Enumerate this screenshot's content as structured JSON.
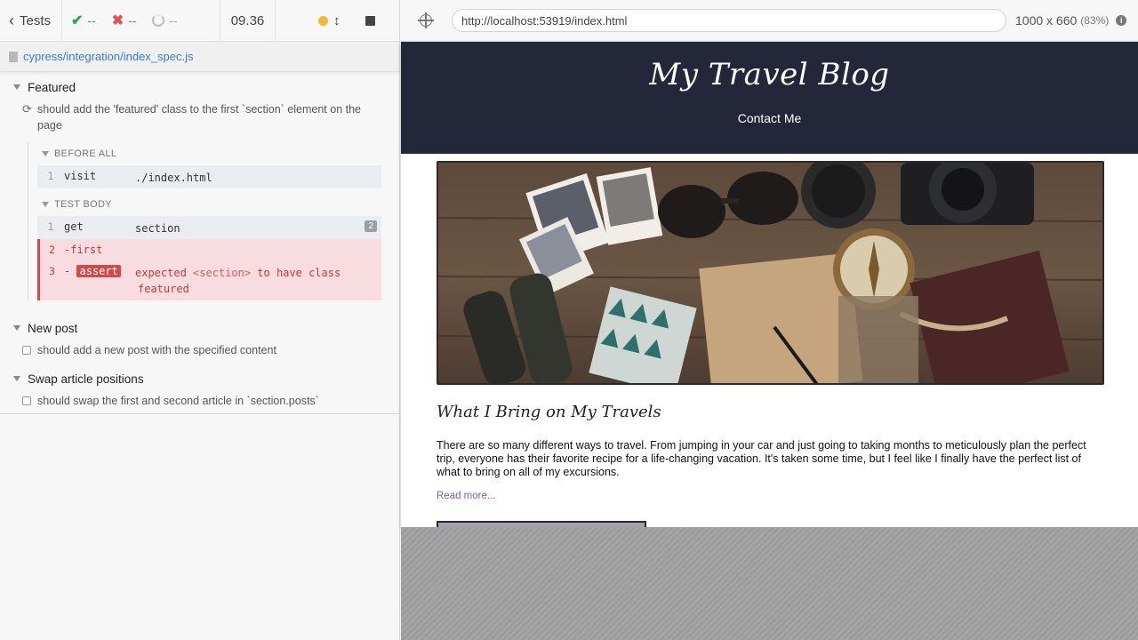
{
  "reporter": {
    "back_label": "Tests",
    "stats": {
      "passed": "--",
      "failed": "--",
      "pending": "--"
    },
    "duration": "09.36",
    "spec_path": "cypress/integration/index_spec.js",
    "suites": [
      {
        "title": "Featured",
        "tests": [
          {
            "title": "should add the 'featured' class to the first `section` element on the page",
            "state": "running",
            "hooks": [
              {
                "title": "BEFORE ALL",
                "commands": [
                  {
                    "num": "1",
                    "name": "visit",
                    "message": "./index.html"
                  }
                ]
              },
              {
                "title": "TEST BODY",
                "commands": [
                  {
                    "num": "1",
                    "name": "get",
                    "message": "section",
                    "count": "2"
                  },
                  {
                    "num": "2",
                    "name": "-first",
                    "message": ""
                  },
                  {
                    "num": "3",
                    "name_prefix": "-",
                    "name": "assert",
                    "message_parts": [
                      "expected ",
                      "<section>",
                      " to have class"
                    ],
                    "message_line2": "featured"
                  }
                ]
              }
            ]
          }
        ]
      },
      {
        "title": "New post",
        "tests": [
          {
            "title": "should add a new post with the specified content",
            "state": "pending"
          }
        ]
      },
      {
        "title": "Swap article positions",
        "tests": [
          {
            "title": "should swap the first and second article in `section.posts`",
            "state": "pending"
          }
        ]
      }
    ]
  },
  "aut": {
    "url": "http://localhost:53919/index.html",
    "viewport": "1000 x 660",
    "scale": "(83%)"
  },
  "blog": {
    "title": "My Travel Blog",
    "nav_link": "Contact Me",
    "article": {
      "title": "What I Bring on My Travels",
      "body": "There are so many different ways to travel. From jumping in your car and just going to taking months to meticulously plan the perfect trip, everyone has their favorite recipe for a life-changing vacation. It's taken some time, but I feel like I finally have the perfect list of what to bring on all of my excursions.",
      "read_more": "Read more..."
    }
  },
  "colors": {
    "pass": "#2da44e",
    "fail": "#e05252",
    "running_yellow": "#f1b73a",
    "blog_header": "#24273a",
    "link": "#3a7bd5"
  }
}
